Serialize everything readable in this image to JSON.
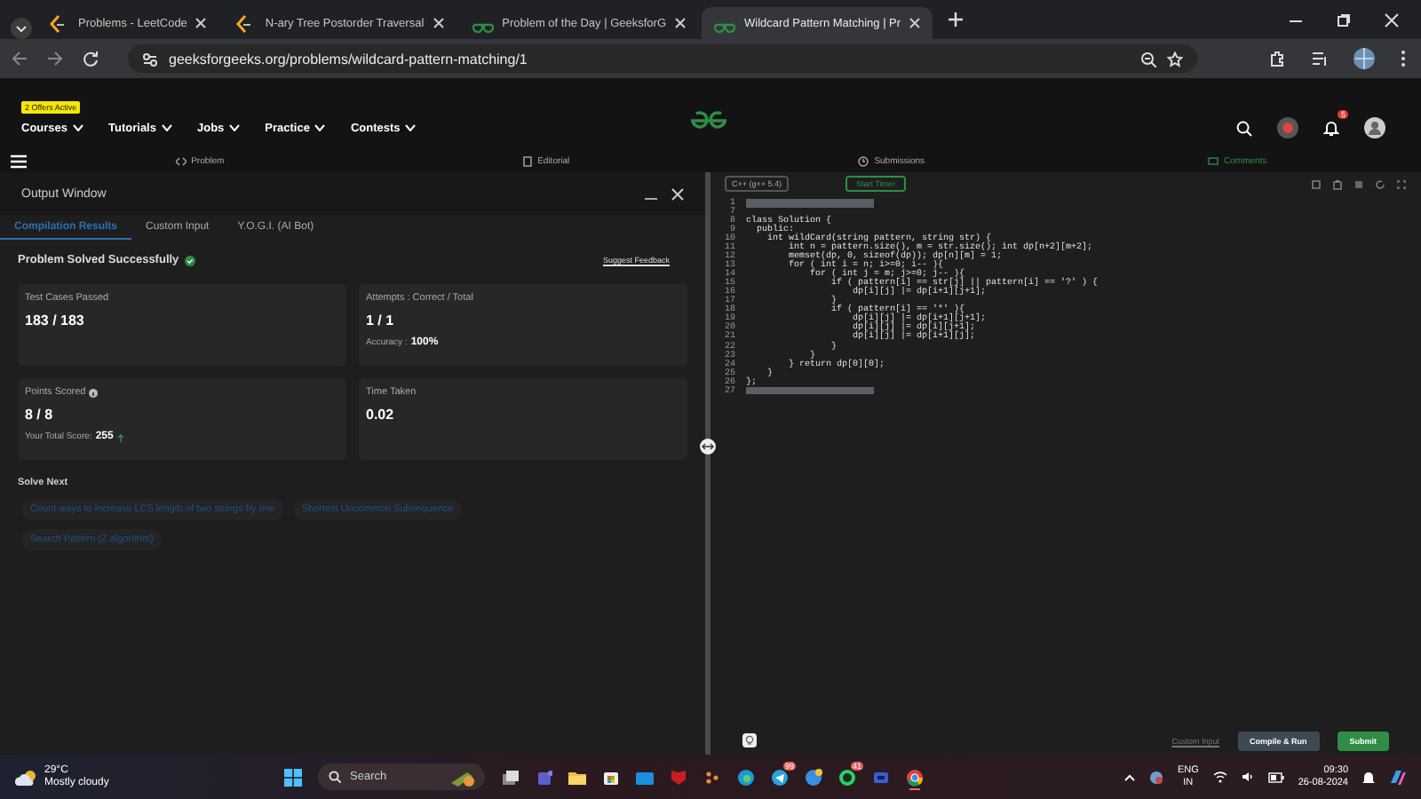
{
  "browser": {
    "tabs": [
      {
        "title": "Problems - LeetCode",
        "kind": "leetcode",
        "selected": false
      },
      {
        "title": "N-ary Tree Postorder Traversal",
        "kind": "leetcode",
        "selected": false
      },
      {
        "title": "Problem of the Day | GeeksforG",
        "kind": "gfg",
        "selected": false
      },
      {
        "title": "Wildcard Pattern Matching | Pr",
        "kind": "gfg",
        "selected": true
      }
    ],
    "url": "geeksforgeeks.org/problems/wildcard-pattern-matching/1"
  },
  "site": {
    "offer_badge": "2 Offers Active",
    "nav": [
      "Courses",
      "Tutorials",
      "Jobs",
      "Practice",
      "Contests"
    ],
    "notification_count": "5",
    "problem_tabs": [
      {
        "label": "Problem",
        "selected": false
      },
      {
        "label": "Editorial",
        "selected": false
      },
      {
        "label": "Submissions",
        "selected": false
      },
      {
        "label": "Comments",
        "selected": true
      }
    ]
  },
  "output": {
    "title": "Output Window",
    "tabs": [
      {
        "label": "Compilation Results",
        "selected": true
      },
      {
        "label": "Custom Input",
        "selected": false
      },
      {
        "label": "Y.O.G.I. (AI Bot)",
        "selected": false
      }
    ],
    "status": "Problem Solved Successfully",
    "feedback": "Suggest Feedback",
    "cards": [
      {
        "label": "Test Cases Passed",
        "value": "183 / 183"
      },
      {
        "label": "Attempts : Correct / Total",
        "value": "1 / 1",
        "note_label": "Accuracy :",
        "note_value": "100%"
      },
      {
        "label": "Points Scored",
        "value": "8 / 8",
        "info": true,
        "note_label": "Your Total Score:",
        "note_value": "255",
        "trend_up": true
      },
      {
        "label": "Time Taken",
        "value": "0.02"
      }
    ],
    "solve_next_title": "Solve Next",
    "solve_next": [
      "Count ways to increase LCS length of two strings by one",
      "Shortest Uncommon Subsequence",
      "Search Pattern (Z algorithm)"
    ]
  },
  "editor": {
    "language": "C++ (g++ 5.4)",
    "timer": "Start Timer",
    "lines": [
      {
        "number": "1",
        "kind": "selection"
      },
      {
        "number": "7",
        "kind": "code"
      },
      {
        "number": "8",
        "kind": "code",
        "code": "class Solution {"
      },
      {
        "number": "9",
        "kind": "code",
        "code": "  public:"
      },
      {
        "number": "10",
        "kind": "code",
        "code": "    int wildCard(string pattern, string str) {"
      },
      {
        "number": "11",
        "kind": "code",
        "code": "        int n = pattern.size(), m = str.size(); int dp[n+2][m+2];"
      },
      {
        "number": "12",
        "kind": "code",
        "code": "        memset(dp, 0, sizeof(dp)); dp[n][m] = 1;"
      },
      {
        "number": "13",
        "kind": "code",
        "code": "        for ( int i = n; i>=0; i-- ){"
      },
      {
        "number": "14",
        "kind": "code",
        "code": "            for ( int j = m; j>=0; j-- ){"
      },
      {
        "number": "15",
        "kind": "code",
        "code": "                if ( pattern[i] == str[j] || pattern[i] == '?' ) {"
      },
      {
        "number": "16",
        "kind": "code",
        "code": "                    dp[i][j] |= dp[i+1][j+1];"
      },
      {
        "number": "17",
        "kind": "code",
        "code": "                }"
      },
      {
        "number": "18",
        "kind": "code",
        "code": "                if ( pattern[i] == '*' ){"
      },
      {
        "number": "19",
        "kind": "code",
        "code": "                    dp[i][j] |= dp[i+1][j+1];"
      },
      {
        "number": "20",
        "kind": "code",
        "code": "                    dp[i][j] |= dp[i][j+1];"
      },
      {
        "number": "21",
        "kind": "code",
        "code": "                    dp[i][j] |= dp[i+1][j];"
      },
      {
        "number": "22",
        "kind": "code",
        "code": "                }"
      },
      {
        "number": "23",
        "kind": "code",
        "code": "            }"
      },
      {
        "number": "24",
        "kind": "code",
        "code": "        } return dp[0][0];"
      },
      {
        "number": "25",
        "kind": "code",
        "code": "    }"
      },
      {
        "number": "26",
        "kind": "code",
        "code": "};"
      },
      {
        "number": "27",
        "kind": "selection"
      }
    ],
    "custom_input": "Custom Input",
    "compile": "Compile & Run",
    "submit": "Submit"
  },
  "taskbar": {
    "temperature": "29°C",
    "weather": "Mostly cloudy",
    "search": "Search",
    "apps": [
      {
        "kind": "taskview",
        "selected": false
      },
      {
        "kind": "teams",
        "selected": false
      },
      {
        "kind": "folder",
        "selected": false
      },
      {
        "kind": "store",
        "selected": false
      },
      {
        "kind": "mail",
        "selected": false
      },
      {
        "kind": "shield",
        "selected": false
      },
      {
        "kind": "dots",
        "selected": false
      },
      {
        "kind": "edge",
        "selected": false
      },
      {
        "kind": "telegram",
        "badge": "99",
        "selected": false
      },
      {
        "kind": "help",
        "selected": false
      },
      {
        "kind": "whatsapp",
        "badge": "41",
        "selected": false
      },
      {
        "kind": "meet",
        "selected": false
      },
      {
        "kind": "chrome",
        "selected": true
      }
    ],
    "language": "ENG",
    "region": "IN",
    "time": "09:30",
    "date": "26-08-2024"
  }
}
